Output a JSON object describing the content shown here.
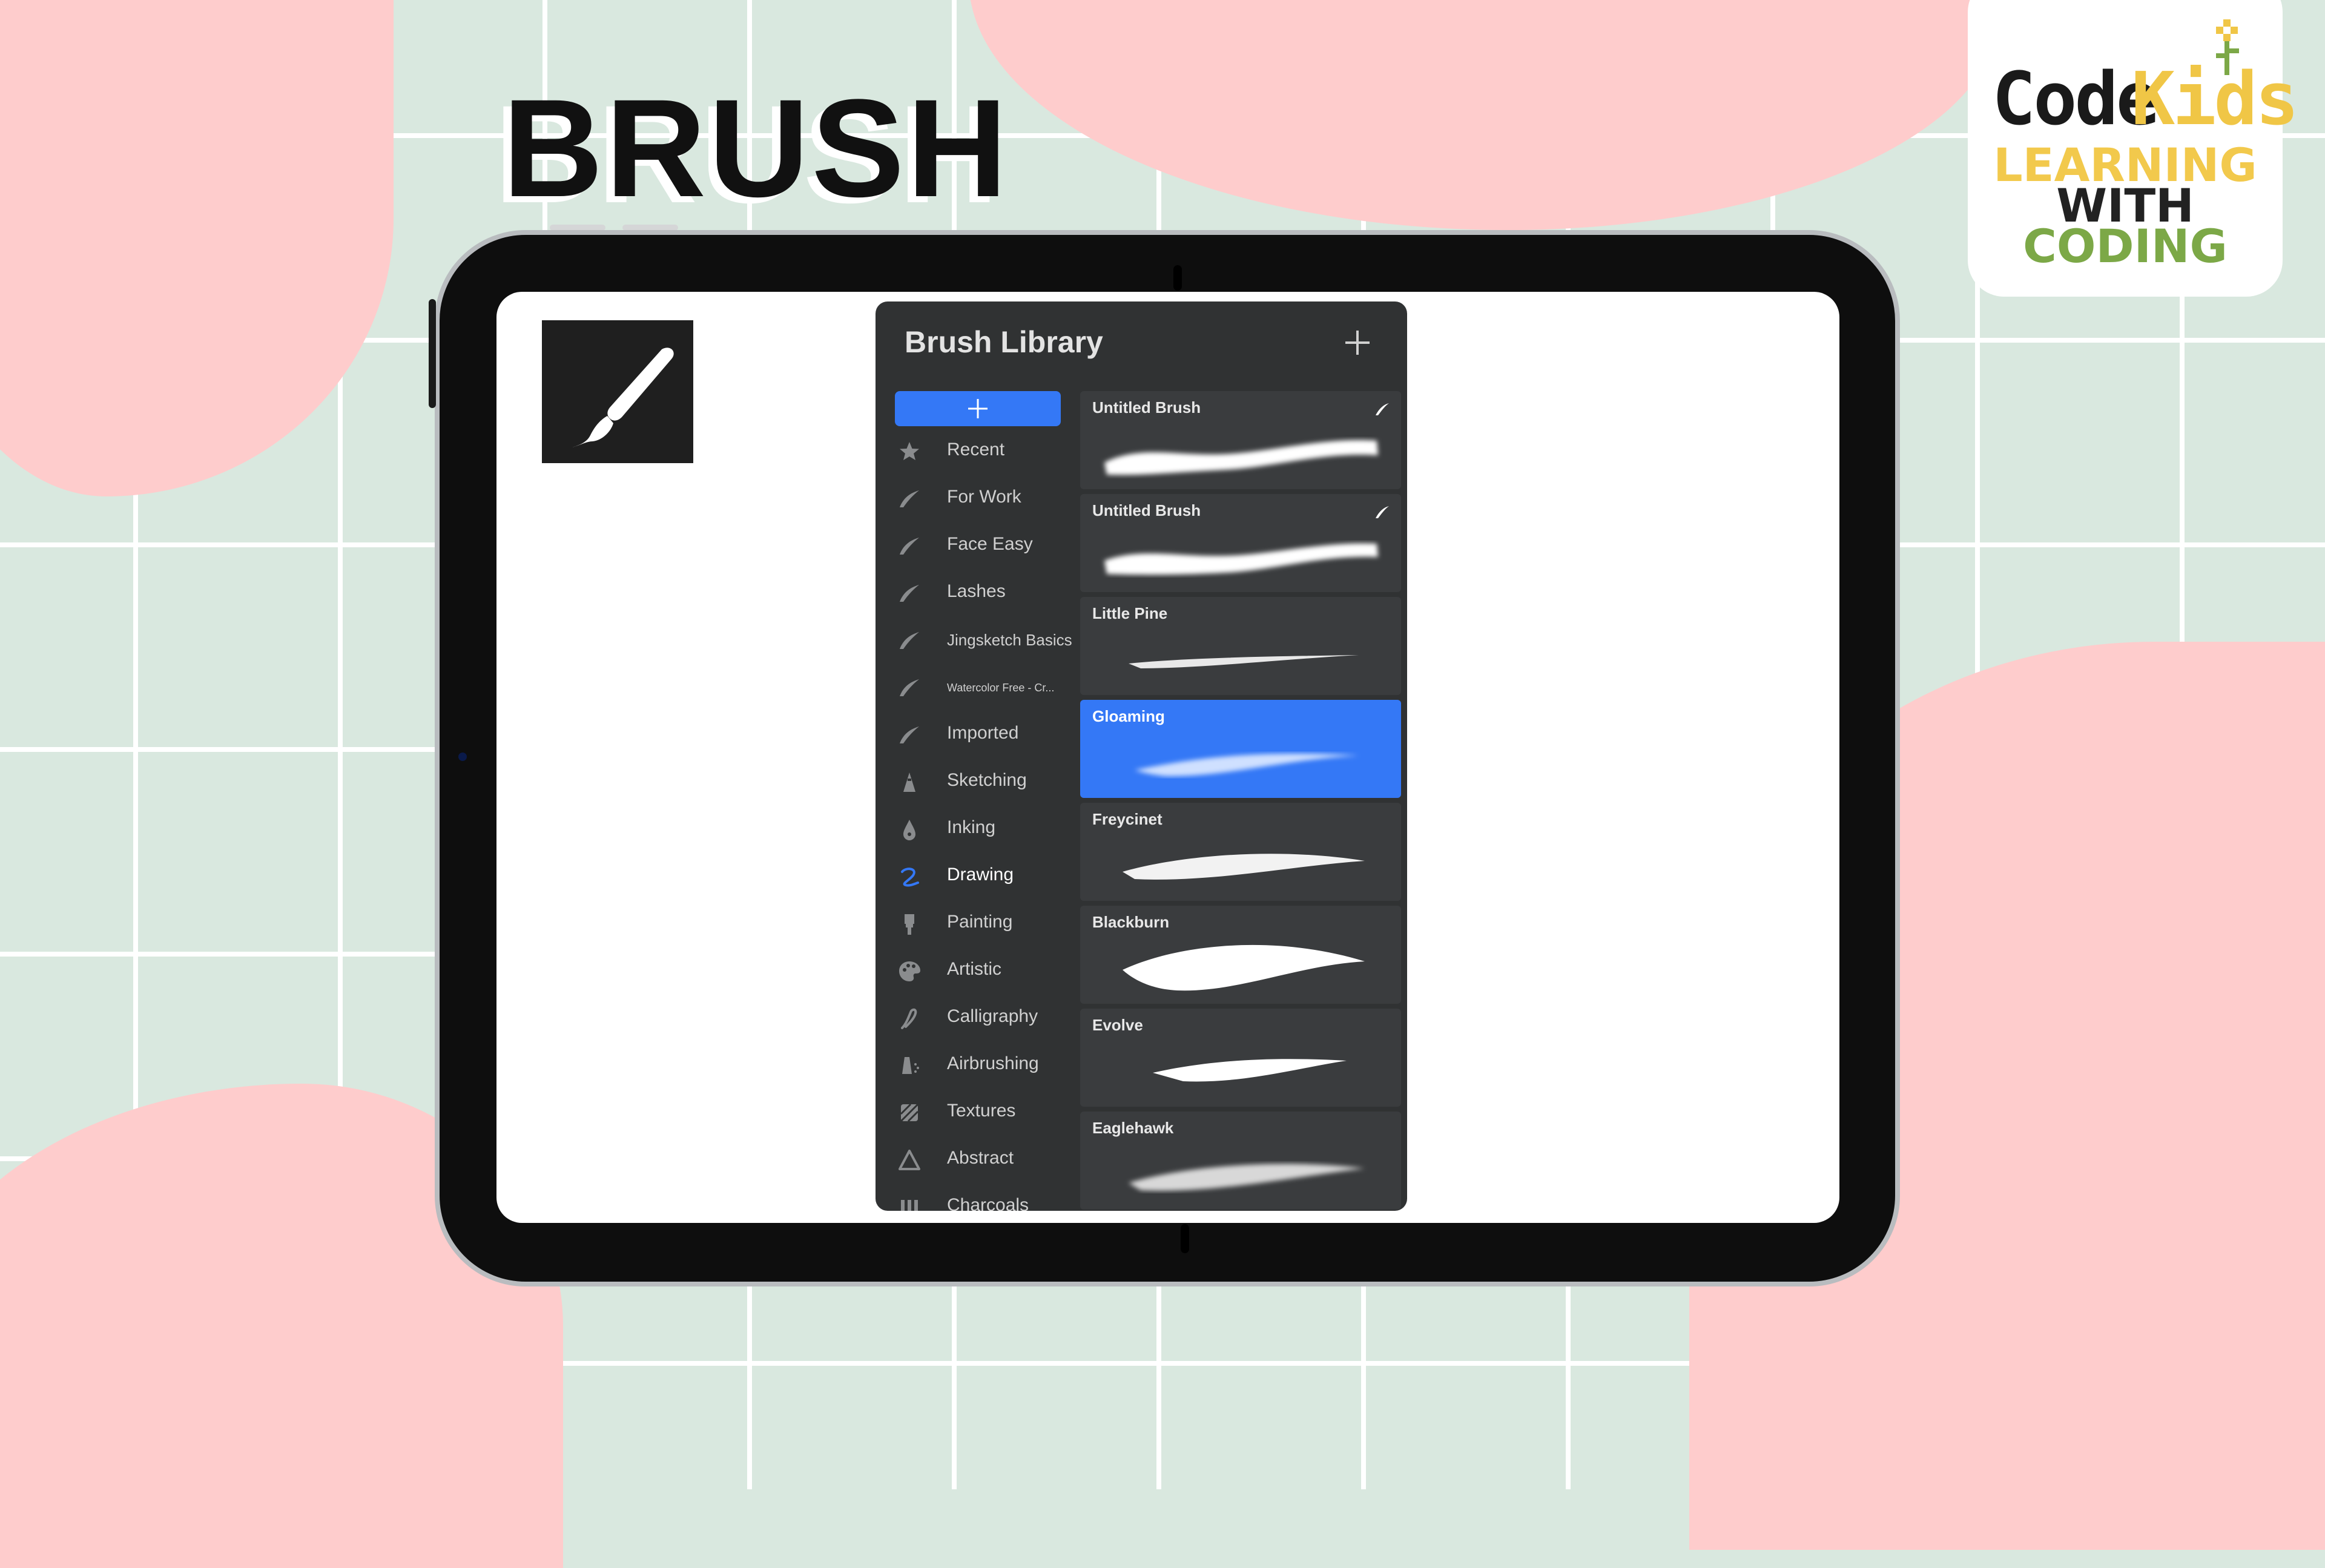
{
  "page": {
    "heading": "BRUSH",
    "logo": {
      "wordmark_code": "Code",
      "wordmark_kids": "Kids",
      "line1": "LEARNING",
      "line2": "WITH",
      "line3": "CODING",
      "colors": {
        "yellow": "#f0c646",
        "green": "#7ca847",
        "dark": "#1a1a1a"
      }
    }
  },
  "colors": {
    "accent": "#3478f6",
    "panel": "#303233",
    "card": "#3a3c3e",
    "blob": "#fecccc",
    "background": "#d9e8df"
  },
  "tool_icon": "paintbrush-icon",
  "brush_library": {
    "title": "Brush Library",
    "add_icon": "plus-icon",
    "categories": [
      {
        "label": "Recent",
        "icon": "star-icon"
      },
      {
        "label": "For Work",
        "icon": "brush-stroke-icon"
      },
      {
        "label": "Face Easy",
        "icon": "brush-stroke-icon"
      },
      {
        "label": "Lashes",
        "icon": "brush-stroke-icon"
      },
      {
        "label": "Jingsketch Basics",
        "icon": "brush-stroke-icon"
      },
      {
        "label": "Watercolor Free - Cr...",
        "icon": "brush-stroke-icon"
      },
      {
        "label": "Imported",
        "icon": "brush-stroke-icon"
      },
      {
        "label": "Sketching",
        "icon": "pencil-tip-icon"
      },
      {
        "label": "Inking",
        "icon": "ink-drop-icon"
      },
      {
        "label": "Drawing",
        "icon": "squiggle-icon",
        "active": true
      },
      {
        "label": "Painting",
        "icon": "paint-brush-icon"
      },
      {
        "label": "Artistic",
        "icon": "palette-icon"
      },
      {
        "label": "Calligraphy",
        "icon": "calligraphy-icon"
      },
      {
        "label": "Airbrushing",
        "icon": "airbrush-icon"
      },
      {
        "label": "Textures",
        "icon": "texture-icon"
      },
      {
        "label": "Abstract",
        "icon": "triangle-icon"
      },
      {
        "label": "Charcoals",
        "icon": "charcoal-icon"
      }
    ],
    "brushes": [
      {
        "name": "Untitled Brush"
      },
      {
        "name": "Untitled Brush"
      },
      {
        "name": "Little Pine"
      },
      {
        "name": "Gloaming",
        "selected": true
      },
      {
        "name": "Freycinet"
      },
      {
        "name": "Blackburn"
      },
      {
        "name": "Evolve"
      },
      {
        "name": "Eaglehawk"
      }
    ]
  }
}
